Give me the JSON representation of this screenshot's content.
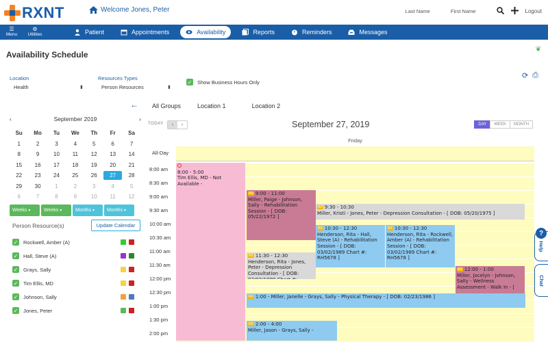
{
  "app": {
    "logo_text": "RXNT",
    "welcome": "Welcome  Jones, Peter"
  },
  "top_right": {
    "last_name": "Last Name",
    "first_name": "First Name",
    "logout": "Logout"
  },
  "nav": {
    "menu": "Menu",
    "utilities": "Utilities",
    "items": [
      {
        "label": "Patient",
        "icon": "person-icon",
        "active": false
      },
      {
        "label": "Appointments",
        "icon": "calendar-icon",
        "active": false
      },
      {
        "label": "Availability",
        "icon": "eye-icon",
        "active": true
      },
      {
        "label": "Reports",
        "icon": "reports-icon",
        "active": false
      },
      {
        "label": "Reminders",
        "icon": "clock-icon",
        "active": false
      },
      {
        "label": "Messages",
        "icon": "inbox-icon",
        "active": false
      }
    ]
  },
  "page": {
    "title": "Availability Schedule"
  },
  "filters": {
    "location_label": "Location",
    "location_value": "Health",
    "resource_label": "Resources Types",
    "resource_value": "Person Resources",
    "business_hours": "Show Business Hours Only"
  },
  "minical": {
    "month": "September 2019",
    "dow": [
      "Su",
      "Mo",
      "Tu",
      "We",
      "Th",
      "Fr",
      "Sa"
    ],
    "weeks": [
      [
        "1",
        "2",
        "3",
        "4",
        "5",
        "6",
        "7"
      ],
      [
        "8",
        "9",
        "10",
        "11",
        "12",
        "13",
        "14"
      ],
      [
        "15",
        "16",
        "17",
        "18",
        "19",
        "20",
        "21"
      ],
      [
        "22",
        "23",
        "24",
        "25",
        "26",
        "27",
        "28"
      ],
      [
        "29",
        "30",
        "1",
        "2",
        "3",
        "4",
        "5"
      ],
      [
        "6",
        "7",
        "8",
        "9",
        "10",
        "11",
        "12"
      ]
    ],
    "selected": "27"
  },
  "view_buttons": [
    {
      "label": "Weeks",
      "color": "#5cb85c"
    },
    {
      "label": "Weeks",
      "color": "#5cb85c"
    },
    {
      "label": "Months",
      "color": "#4fc3d9"
    },
    {
      "label": "Months",
      "color": "#4fc3d9"
    }
  ],
  "resources": {
    "title": "Person Resource(s)",
    "update": "Update Calendar",
    "items": [
      {
        "name": "Rockwell, Amber (A)",
        "c1": "#33cc33",
        "c2": "#cc2222"
      },
      {
        "name": "Hall, Steve (A)",
        "c1": "#9933cc",
        "c2": "#2a8a2a"
      },
      {
        "name": "Grays, Sally",
        "c1": "#f5d442",
        "c2": "#cc2222"
      },
      {
        "name": "Tim Ellis, MD",
        "c1": "#f5d442",
        "c2": "#cc2222"
      },
      {
        "name": "Johnson, Sally",
        "c1": "#f0a040",
        "c2": "#4a7ac0"
      },
      {
        "name": "Jones, Peter",
        "c1": "#5cb85c",
        "c2": "#cc2222"
      }
    ]
  },
  "schedule": {
    "tabs": [
      "All Groups",
      "Location 1",
      "Location 2"
    ],
    "today": "TODAY",
    "date": "September 27, 2019",
    "views": [
      "DAY",
      "WEEK",
      "MONTH"
    ],
    "day": "Friday",
    "all_day": "All-Day",
    "times": [
      "8:00 am",
      "8:30 am",
      "9:00 am",
      "9:30 am",
      "10:00 am",
      "10:30 am",
      "11:00 am",
      "11:30 am",
      "12:00 pm",
      "12:30 pm",
      "1:00 pm",
      "1:30 pm",
      "2:00 pm"
    ],
    "tag": "RX",
    "events": [
      {
        "id": "ellis",
        "time": "8:00 - 5:00",
        "text": "Tim Ellis, MD - Not Available -",
        "color": "#f7bcd4",
        "col": 0,
        "span": 1,
        "start": 8.0,
        "end": 14.5,
        "google": true
      },
      {
        "id": "paige",
        "time": "9:00 - 11:00",
        "text": "Miller, Paige - Johnson, Sally - Rehabilitation Session - [ DOB: 05/22/1972 ]",
        "color": "#c97b95",
        "col": 1,
        "span": 1,
        "start": 9.0,
        "end": 10.83
      },
      {
        "id": "kristi",
        "time": "9:30 - 10:30",
        "text": "Miller, Kristi - Jones, Peter - Depression Consultation - [ DOB: 05/20/1975 ]",
        "color": "#d9d9d9",
        "col": 2,
        "span": 3,
        "start": 9.5,
        "end": 10.08
      },
      {
        "id": "rita1",
        "time": "10:30 - 12:30",
        "text": "Henderson, Rita - Hall, Steve (A) - Rehabilitation Session - [ DOB: 03/02/1989 Chart #: RH5678 ]",
        "color": "#8fcaf0",
        "col": 2,
        "span": 1,
        "start": 10.28,
        "end": 11.83
      },
      {
        "id": "rita2",
        "time": "10:30 - 12:30",
        "text": "Henderson, Rita - Rockwell, Amber (A) - Rehabilitation Session - [ DOB: 03/02/1989 Chart #: RH5678 ]",
        "color": "#8fcaf0",
        "col": 3,
        "span": 1,
        "start": 10.28,
        "end": 11.83
      },
      {
        "id": "rita3",
        "time": "11:30 - 12:30",
        "text": "Henderson, Rita - Jones, Peter - Depression Consultation - [ DOB: 03/02/1989 Chart #: RH5678 ]",
        "color": "#d9d9d9",
        "col": 1,
        "span": 1,
        "start": 11.28,
        "end": 12.25
      },
      {
        "id": "jocelyn",
        "time": "12:00 - 1:00",
        "text": "Miller, Jocelyn - Johnson, Sally - Wellness Assessment - Walk In - [",
        "color": "#c97b95",
        "col": 4,
        "span": 1,
        "start": 11.78,
        "end": 13.0
      },
      {
        "id": "janelle",
        "time": "1:00 - Miller, Janelle - Grays, Sally - Physical Therapy - [ DOB: 02/23/1986 ]",
        "text": "",
        "color": "#8fcaf0",
        "col": 1,
        "span": 4,
        "start": 12.78,
        "end": 13.3
      },
      {
        "id": "jason",
        "time": "2:00 - 4:00",
        "text": "Miller, Jason - Grays, Sally -",
        "color": "#8fcaf0",
        "col": 1,
        "span": 1.3,
        "start": 13.78,
        "end": 14.5
      }
    ]
  },
  "side_tabs": {
    "help": "Help",
    "chat": "Chat",
    "q": "?"
  }
}
